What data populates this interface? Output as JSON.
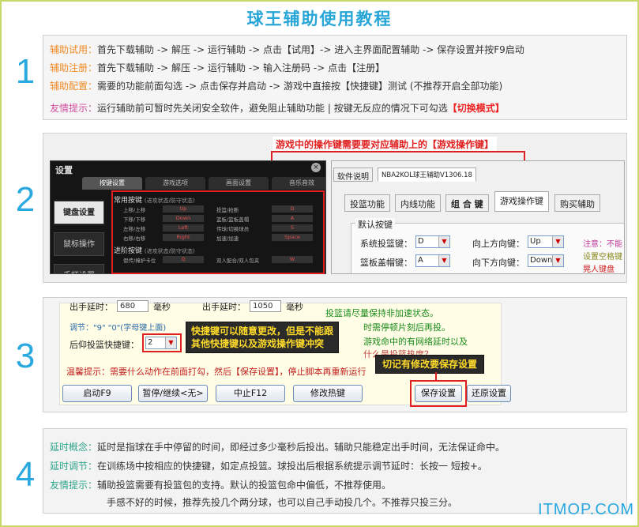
{
  "title": "球王辅助使用教程",
  "steps": {
    "s1": "1",
    "s2": "2",
    "s3": "3",
    "s4": "4"
  },
  "section1": {
    "lines": [
      {
        "label": "辅助试用：",
        "text": "首先下载辅助 -> 解压 -> 运行辅助 -> 点击【试用】-> 进入主界面配置辅助 -> 保存设置并按F9启动"
      },
      {
        "label": "辅助注册：",
        "text": "首先下载辅助 -> 解压 -> 运行辅助 -> 输入注册码 -> 点击【注册】"
      },
      {
        "label": "辅助配置：",
        "text": "需要的功能前面勾选 -> 点击保存并启动 -> 游戏中直接按【快捷键】测试 (不推荐开启全部功能)"
      }
    ],
    "tip_label": "友情提示：",
    "tip_text": "运行辅助前可暂时先关闭安全软件，避免阻止辅助功能 | 按键无反应的情况下可勾选",
    "tip_highlight": "【切换模式】"
  },
  "section2": {
    "callout": "游戏中的操作键需要要对应辅助上的【游戏操作键】",
    "game_settings": {
      "title": "设置",
      "tabs": [
        "按键设置",
        "游戏选项",
        "画面设置",
        "音乐音效"
      ],
      "side": [
        "键盘设置",
        "鼠标操作",
        "手柄设置"
      ],
      "group1": "常用按键",
      "group1_note": "(进攻状态/防守状态)",
      "group2": "进阶按键",
      "group2_note": "(进攻状态/防守状态)",
      "rows": [
        {
          "a": "上移/上移",
          "av": "Up",
          "b": "投篮/抢断",
          "bv": "D"
        },
        {
          "a": "下移/下移",
          "av": "Down",
          "b": "篮板/篮板盖帽",
          "bv": "A"
        },
        {
          "a": "左移/左移",
          "av": "Left",
          "b": "传球/切换球员",
          "bv": "S"
        },
        {
          "a": "右移/右移",
          "av": "Right",
          "b": "加速/加速",
          "bv": "Space"
        }
      ],
      "adv_row": {
        "a": "假传/掩护卡位",
        "av": "Q",
        "b": "双人配合/双人包夹",
        "bv": "W"
      }
    },
    "helper_app": {
      "top_tabs": [
        "软件说明",
        "NBA2KOL球王辅助V1306.18"
      ],
      "tabs": [
        "投篮功能",
        "内线功能",
        "组 合 键",
        "游戏操作键",
        "购买辅助"
      ],
      "group": "默认按键",
      "rows": [
        {
          "l1": "系统投篮键：",
          "v1": "D",
          "l2": "向上方向键：",
          "v2": "Up"
        },
        {
          "l1": "篮板盖帽键：",
          "v1": "A",
          "l2": "向下方向键：",
          "v2": "Down"
        }
      ],
      "notes": [
        "注意：不能",
        "设置空格键",
        "晃人键盘"
      ]
    }
  },
  "section3": {
    "top_left": "出手延时：",
    "top_left_val": "680",
    "unit": "毫秒",
    "top_mid": "出手延时：",
    "top_mid_val": "1050",
    "hint_keys": "调节：\"9\" \"0\"(字母键上面)",
    "hotkey_label": "后仰投篮快捷键：",
    "hotkey_val": "2",
    "right_notes": [
      "投篮请尽量保持非加速状态。",
      "时需停顿片刻后再投。",
      "游戏命中的有网络延时以及",
      "什么是投篮热度？"
    ],
    "tooltip1_l1": "快捷键可以随意更改，但是不能跟",
    "tooltip1_l2": "其他快捷键以及游戏操作键冲突",
    "warm_tip": "温馨提示：需要什么动作在前面打勾，然后【保存设置】，停止脚本再重新运行",
    "tooltip2": "切记有修改要保存设置",
    "buttons": [
      "启动F9",
      "暂停/继续<无>",
      "中止F12",
      "修改热键",
      "保存设置",
      "还原设置"
    ]
  },
  "section4": {
    "lines": [
      {
        "label": "延时概念：",
        "text": "延时是指球在手中停留的时间，即经过多少毫秒后投出。辅助只能稳定出手时间，无法保证命中。"
      },
      {
        "label": "延时调节：",
        "text": "在训练场中按相应的快捷键，如定点投篮。球投出后根据系统提示调节延时：长按一 短按+。"
      },
      {
        "label": "友情提示：",
        "text": "辅助投篮需要有投篮包的支持。默认的投篮包命中偏低，不推荐使用。"
      }
    ],
    "extra": "手感不好的时候，推荐先投几个两分球，也可以自己手动投几个。不推荐只投三分。"
  },
  "watermark": "ITMOP.COM"
}
